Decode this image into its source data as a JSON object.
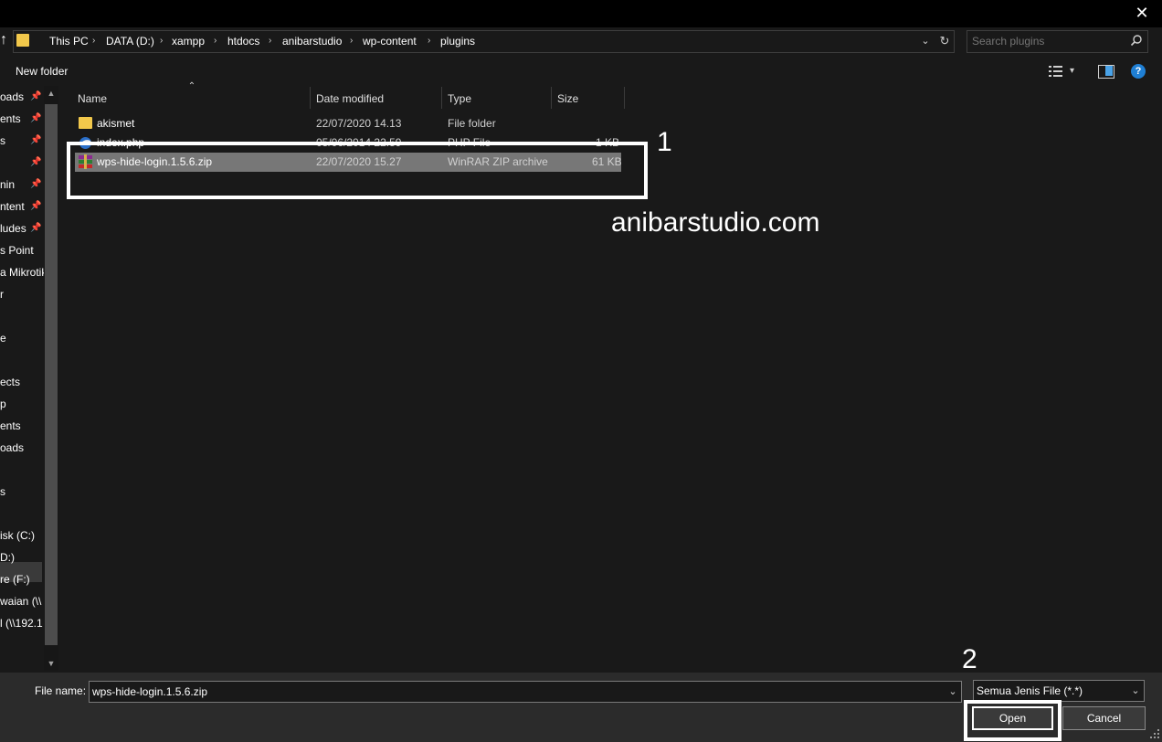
{
  "window": {
    "close_glyph": "✕"
  },
  "address": {
    "crumbs": [
      "This PC",
      "DATA (D:)",
      "xampp",
      "htdocs",
      "anibarstudio",
      "wp-content",
      "plugins"
    ],
    "separator": "›",
    "up_glyph": "↑",
    "dropdown_glyph": "⌄",
    "refresh_glyph": "↻"
  },
  "search": {
    "placeholder": "Search plugins"
  },
  "toolbar": {
    "new_folder": "New folder",
    "view_dropdown_glyph": "▾",
    "help_glyph": "?"
  },
  "nav": {
    "items": [
      {
        "label": "oads",
        "pinned": true
      },
      {
        "label": "ents",
        "pinned": true
      },
      {
        "label": "s",
        "pinned": true
      },
      {
        "label": "",
        "pinned": true
      },
      {
        "label": "nin",
        "pinned": true
      },
      {
        "label": "ntent",
        "pinned": true
      },
      {
        "label": "ludes",
        "pinned": true
      },
      {
        "label": "s Point",
        "pinned": false
      },
      {
        "label": "a Mikrotik",
        "pinned": false
      },
      {
        "label": "r",
        "pinned": false
      },
      {
        "label": "",
        "pinned": false
      },
      {
        "label": "e",
        "pinned": false
      },
      {
        "label": "",
        "pinned": false
      },
      {
        "label": "ects",
        "pinned": false
      },
      {
        "label": "p",
        "pinned": false
      },
      {
        "label": "ents",
        "pinned": false
      },
      {
        "label": "oads",
        "pinned": false
      },
      {
        "label": "",
        "pinned": false
      },
      {
        "label": "s",
        "pinned": false
      },
      {
        "label": "",
        "pinned": false
      },
      {
        "label": "isk (C:)",
        "pinned": false
      },
      {
        "label": "D:)",
        "pinned": false
      },
      {
        "label": "re (F:)",
        "pinned": false
      },
      {
        "label": "waian (\\\\",
        "pinned": false
      },
      {
        "label": "l (\\\\192.1",
        "pinned": false
      }
    ],
    "pin_glyph": "📌",
    "selected_item": "D:)"
  },
  "columns": {
    "name": "Name",
    "date": "Date modified",
    "type": "Type",
    "size": "Size"
  },
  "files": [
    {
      "name": "akismet",
      "date": "22/07/2020 14.13",
      "type": "File folder",
      "size": "",
      "icon": "folder-icon"
    },
    {
      "name": "index.php",
      "date": "05/06/2014 22.59",
      "type": "PHP File",
      "size": "1 KB",
      "icon": "php-file-icon"
    },
    {
      "name": "wps-hide-login.1.5.6.zip",
      "date": "22/07/2020 15.27",
      "type": "WinRAR ZIP archive",
      "size": "61 KB",
      "icon": "winrar-zip-icon",
      "selected": true
    }
  ],
  "annotations": {
    "label_1": "1",
    "label_2": "2",
    "watermark": "anibarstudio.com"
  },
  "bottom": {
    "file_name_label": "File name:",
    "file_name_value": "wps-hide-login.1.5.6.zip",
    "file_type_value": "Semua Jenis File (*.*)",
    "open_label": "Open",
    "cancel_label": "Cancel"
  },
  "colors": {
    "background": "#191919",
    "selection": "#777777",
    "folder": "#f2c84b",
    "help_blue": "#1f7fd4"
  }
}
